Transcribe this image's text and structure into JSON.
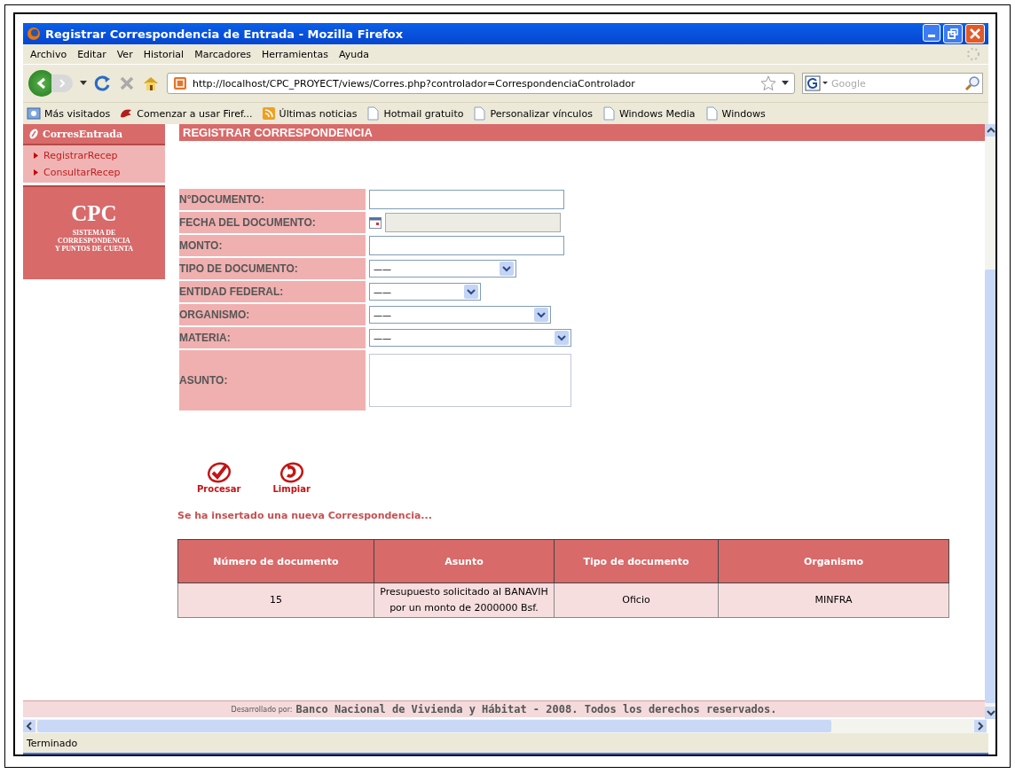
{
  "window": {
    "title": "Registrar Correspondencia de Entrada - Mozilla Firefox"
  },
  "menu": [
    "Archivo",
    "Editar",
    "Ver",
    "Historial",
    "Marcadores",
    "Herramientas",
    "Ayuda"
  ],
  "address": {
    "url": "http://localhost/CPC_PROYECT/views/Corres.php?controlador=CorrespondenciaControlador"
  },
  "search": {
    "placeholder": "Google"
  },
  "bookmarks": [
    {
      "label": "Más visitados",
      "kind": "folder"
    },
    {
      "label": "Comenzar a usar Firef...",
      "kind": "fox"
    },
    {
      "label": "Últimas noticias",
      "kind": "feed"
    },
    {
      "label": "Hotmail gratuito",
      "kind": "page"
    },
    {
      "label": "Personalizar vínculos",
      "kind": "page"
    },
    {
      "label": "Windows Media",
      "kind": "page"
    },
    {
      "label": "Windows",
      "kind": "page"
    }
  ],
  "sidebar": {
    "header": "CorresEntrada",
    "items": [
      "RegistrarRecep",
      "ConsultarRecep"
    ],
    "logo": {
      "title": "CPC",
      "subtitle_lines": [
        "SISTEMA DE",
        "CORRESPONDENCIA",
        "Y PUNTOS  DE CUENTA"
      ]
    }
  },
  "form": {
    "title": "REGISTRAR CORRESPONDENCIA",
    "fields": [
      {
        "label": "N°DOCUMENTO:",
        "kind": "text"
      },
      {
        "label": "FECHA DEL DOCUMENTO:",
        "kind": "date",
        "disabled": true
      },
      {
        "label": "MONTO:",
        "kind": "text"
      },
      {
        "label": "TIPO DE DOCUMENTO:",
        "kind": "select",
        "value": "——"
      },
      {
        "label": "ENTIDAD FEDERAL:",
        "kind": "select",
        "value": "——"
      },
      {
        "label": "ORGANISMO:",
        "kind": "select",
        "value": "——"
      },
      {
        "label": "MATERIA:",
        "kind": "select",
        "value": "——"
      },
      {
        "label": "ASUNTO:",
        "kind": "textarea"
      }
    ],
    "buttons": [
      {
        "label": "Procesar",
        "kind": "check"
      },
      {
        "label": "Limpiar",
        "kind": "reset"
      }
    ],
    "message": "Se ha insertado una nueva Correspondencia..."
  },
  "table": {
    "columns": [
      "Número de documento",
      "Asunto",
      "Tipo de documento",
      "Organismo"
    ],
    "rows": [
      [
        "15",
        "Presupuesto solicitado al BANAVIH por un monto de 2000000 Bsf.",
        "Oficio",
        "MINFRA"
      ]
    ]
  },
  "footer": {
    "prefix": "Desarrollado por:",
    "text": "Banco Nacional de Vivienda y Hábitat - 2008. Todos los derechos reservados."
  },
  "status_bar": "Terminado"
}
